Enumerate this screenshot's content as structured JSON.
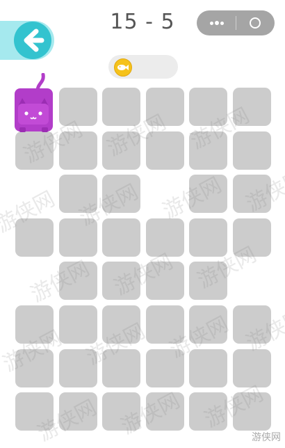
{
  "header": {
    "level": "15 - 5",
    "back_icon": "arrow-left-icon",
    "menu_icon": "more-dots-icon",
    "close_icon": "target-icon"
  },
  "coins": {
    "icon": "fish-coin-icon",
    "count": ""
  },
  "board": {
    "rows": [
      [
        0,
        1,
        1,
        1,
        1,
        1
      ],
      [
        1,
        1,
        1,
        1,
        1,
        1
      ],
      [
        0,
        1,
        1,
        0,
        1,
        1
      ],
      [
        1,
        1,
        1,
        1,
        1,
        1
      ],
      [
        0,
        1,
        1,
        1,
        1,
        0
      ],
      [
        1,
        1,
        1,
        1,
        1,
        1
      ],
      [
        1,
        1,
        1,
        1,
        1,
        1
      ],
      [
        1,
        1,
        1,
        1,
        1,
        1
      ]
    ],
    "player": {
      "row": 0,
      "col": 0,
      "color": "#b23dc9"
    },
    "tile_color": "#cccccc"
  },
  "colors": {
    "accent": "#33c3cf",
    "coin": "#f5c21b",
    "cat": "#b23dc9"
  },
  "watermark": {
    "text": "游侠网",
    "corner_text": "游侠网"
  }
}
